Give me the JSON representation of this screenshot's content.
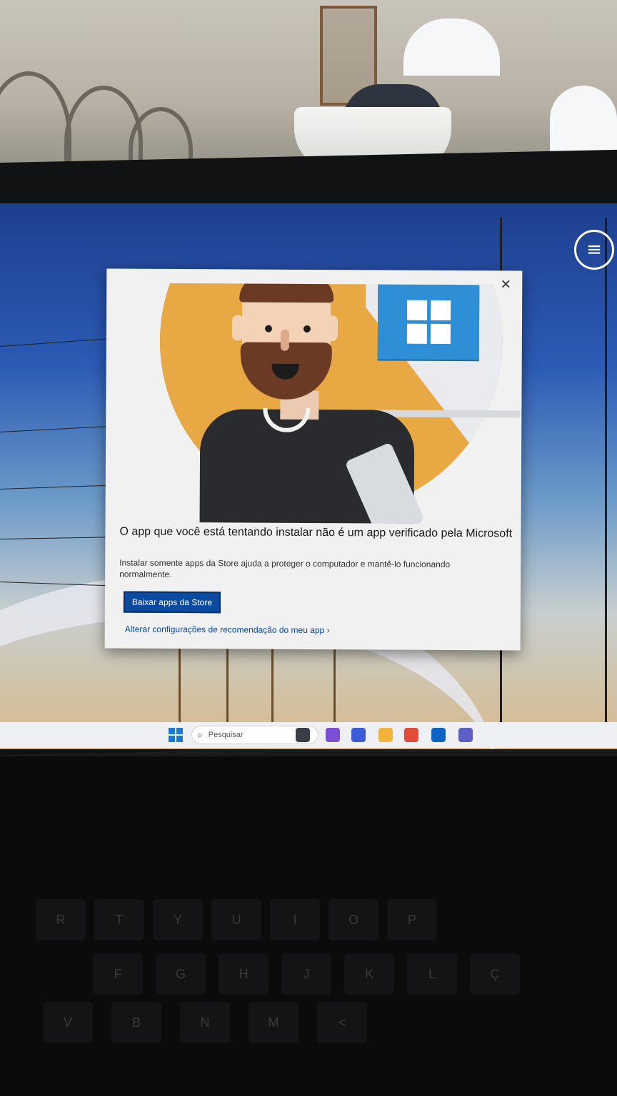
{
  "dialog": {
    "title": "O app que você está tentando instalar não é um app verificado pela Microsoft",
    "description": "Instalar somente apps da Store ajuda a proteger o computador e mantê-lo funcionando normalmente.",
    "primary_button": "Baixar apps da Store",
    "link": "Alterar configurações de recomendação do meu app",
    "link_chevron": "›",
    "close_glyph": "✕"
  },
  "taskbar": {
    "search_placeholder": "Pesquisar",
    "search_glyph": "⌕",
    "apps": [
      {
        "name": "camera",
        "color": "#3a3f47"
      },
      {
        "name": "copilot",
        "color": "#7a4fd6"
      },
      {
        "name": "meet",
        "color": "#3c5bd9"
      },
      {
        "name": "file-explorer",
        "color": "#f2b53a"
      },
      {
        "name": "chrome",
        "color": "#e04b3a"
      },
      {
        "name": "outlook",
        "color": "#0a64c8"
      },
      {
        "name": "teams",
        "color": "#5b5fc7"
      }
    ]
  },
  "desktop": {
    "menu_glyph": "≡"
  },
  "keyboard": {
    "row1": [
      "R",
      "T",
      "Y",
      "U",
      "I",
      "O",
      "P"
    ],
    "row2": [
      "F",
      "G",
      "H",
      "J",
      "K",
      "L",
      "Ç"
    ],
    "row3": [
      "V",
      "B",
      "N",
      "M",
      "<"
    ]
  },
  "colors": {
    "accent": "#0a4aa0",
    "windows_blue": "#1a78d6",
    "illustration_orange": "#e8a844"
  }
}
